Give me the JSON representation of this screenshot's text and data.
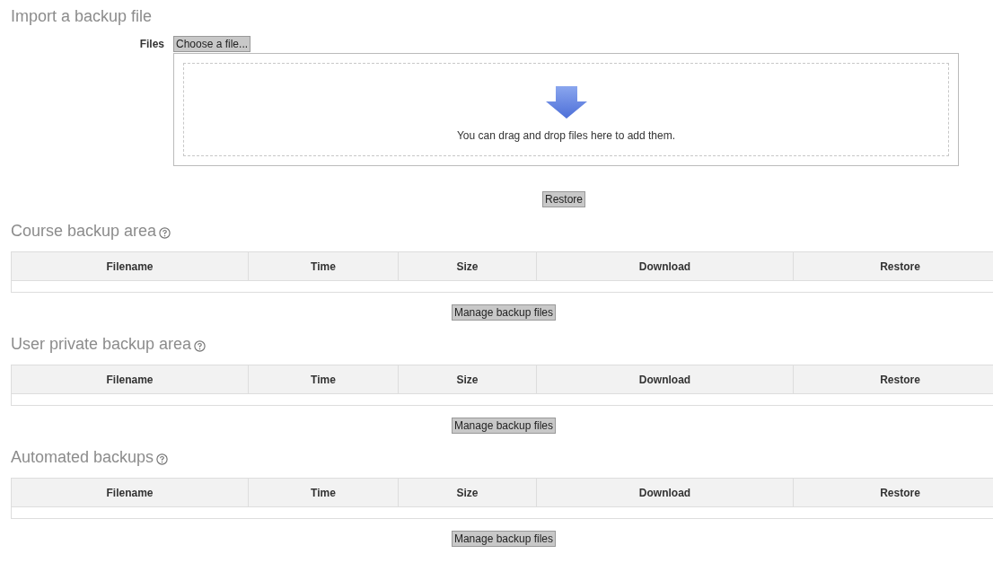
{
  "import": {
    "title": "Import a backup file",
    "files_label": "Files",
    "choose_button": "Choose a file...",
    "drop_hint": "You can drag and drop files here to add them.",
    "restore_button": "Restore"
  },
  "sections": [
    {
      "title": "Course backup area",
      "columns": [
        "Filename",
        "Time",
        "Size",
        "Download",
        "Restore"
      ],
      "button": "Manage backup files"
    },
    {
      "title": "User private backup area",
      "columns": [
        "Filename",
        "Time",
        "Size",
        "Download",
        "Restore"
      ],
      "button": "Manage backup files"
    },
    {
      "title": "Automated backups",
      "columns": [
        "Filename",
        "Time",
        "Size",
        "Download",
        "Restore"
      ],
      "button": "Manage backup files"
    }
  ]
}
